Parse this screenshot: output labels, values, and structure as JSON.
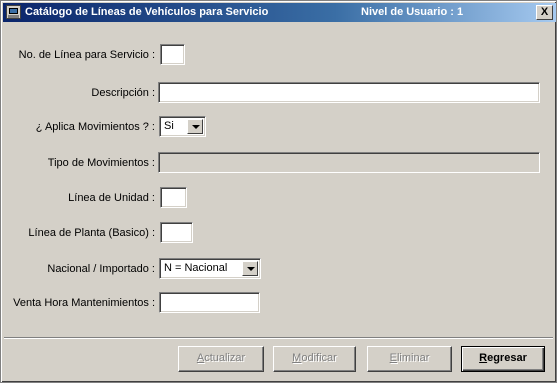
{
  "window": {
    "title": "Catálogo de Líneas de Vehículos para Servicio",
    "user_level": "Nivel de Usuario : 1",
    "close_glyph": "X",
    "icon": "app-computer-icon"
  },
  "form": {
    "linea_label": "No. de Línea para Servicio :",
    "linea_value": "",
    "descripcion_label": "Descripción :",
    "descripcion_value": "",
    "aplica_label": "¿ Aplica Movimientos ? :",
    "aplica_value": "Si",
    "tipo_label": "Tipo de Movimientos :",
    "tipo_value": "",
    "linea_unidad_label": "Línea de Unidad :",
    "linea_unidad_value": "",
    "linea_planta_label": "Línea de Planta (Basico) :",
    "linea_planta_value": "",
    "nacional_label": "Nacional / Importado :",
    "nacional_value": "N = Nacional",
    "venta_label": "Venta Hora Mantenimientos :",
    "venta_value": ""
  },
  "buttons": {
    "actualizar_first": "A",
    "actualizar_rest": "ctualizar",
    "modificar_first": "M",
    "modificar_rest": "odificar",
    "eliminar_first": "E",
    "eliminar_rest": "liminar",
    "regresar_first": "R",
    "regresar_rest": "egresar"
  }
}
